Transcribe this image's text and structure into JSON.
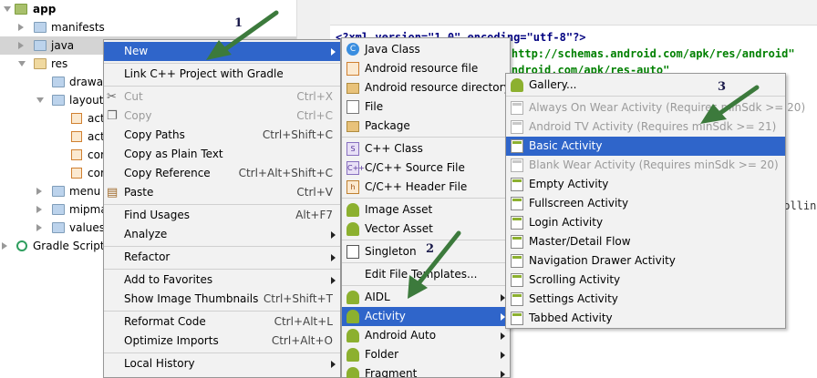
{
  "tree": {
    "items": [
      {
        "label": "app",
        "bold": true
      },
      {
        "label": "manifests"
      },
      {
        "label": "java"
      },
      {
        "label": "res"
      },
      {
        "label": "drawab"
      },
      {
        "label": "layout"
      },
      {
        "label": "act"
      },
      {
        "label": "act"
      },
      {
        "label": "cor"
      },
      {
        "label": "cor"
      },
      {
        "label": "menu"
      },
      {
        "label": "mipma"
      },
      {
        "label": "values"
      },
      {
        "label": "Gradle Scripts"
      }
    ]
  },
  "editor": {
    "line1": "<?xml version=\"1.0\" encoding=\"utf-8\"?>",
    "line2": "id=\"http://schemas.android.com/apk/res/android\"",
    "line3": "as.android.com/apk/res-auto\"",
    "line4": "rollin"
  },
  "context_menu": {
    "items": [
      {
        "label": "New",
        "shortcut": "",
        "submenu": true
      },
      {
        "label": "Link C++ Project with Gradle",
        "shortcut": ""
      },
      {
        "label": "Cut",
        "shortcut": "Ctrl+X",
        "disabled": true
      },
      {
        "label": "Copy",
        "shortcut": "Ctrl+C",
        "disabled": true
      },
      {
        "label": "Copy Paths",
        "shortcut": "Ctrl+Shift+C"
      },
      {
        "label": "Copy as Plain Text",
        "shortcut": ""
      },
      {
        "label": "Copy Reference",
        "shortcut": "Ctrl+Alt+Shift+C"
      },
      {
        "label": "Paste",
        "shortcut": "Ctrl+V"
      },
      {
        "label": "Find Usages",
        "shortcut": "Alt+F7"
      },
      {
        "label": "Analyze",
        "shortcut": "",
        "submenu": true
      },
      {
        "label": "Refactor",
        "shortcut": "",
        "submenu": true
      },
      {
        "label": "Add to Favorites",
        "shortcut": "",
        "submenu": true
      },
      {
        "label": "Show Image Thumbnails",
        "shortcut": "Ctrl+Shift+T"
      },
      {
        "label": "Reformat Code",
        "shortcut": "Ctrl+Alt+L"
      },
      {
        "label": "Optimize Imports",
        "shortcut": "Ctrl+Alt+O"
      },
      {
        "label": "Local History",
        "shortcut": "",
        "submenu": true
      }
    ]
  },
  "new_menu": {
    "items": [
      {
        "label": "Java Class",
        "icon": "java-class-icon"
      },
      {
        "label": "Android resource file",
        "icon": "android-resource-file-icon"
      },
      {
        "label": "Android resource directory",
        "icon": "folder-icon"
      },
      {
        "label": "File",
        "icon": "file-icon"
      },
      {
        "label": "Package",
        "icon": "package-icon"
      },
      {
        "label": "C++ Class",
        "icon": "cpp-class-icon"
      },
      {
        "label": "C/C++ Source File",
        "icon": "cpp-source-icon"
      },
      {
        "label": "C/C++ Header File",
        "icon": "cpp-header-icon"
      },
      {
        "label": "Image Asset",
        "icon": "android-icon"
      },
      {
        "label": "Vector Asset",
        "icon": "android-icon"
      },
      {
        "label": "Singleton",
        "icon": "singleton-icon"
      },
      {
        "label": "Edit File Templates...",
        "icon": ""
      },
      {
        "label": "AIDL",
        "icon": "android-icon",
        "submenu": true
      },
      {
        "label": "Activity",
        "icon": "android-icon",
        "submenu": true
      },
      {
        "label": "Android Auto",
        "icon": "android-icon",
        "submenu": true
      },
      {
        "label": "Folder",
        "icon": "android-icon",
        "submenu": true
      },
      {
        "label": "Fragment",
        "icon": "android-icon",
        "submenu": true
      }
    ]
  },
  "activity_menu": {
    "items": [
      {
        "label": "Gallery...",
        "disabled": false
      },
      {
        "label": "Always On Wear Activity (Requires minSdk >= 20)",
        "disabled": true
      },
      {
        "label": "Android TV Activity (Requires minSdk >= 21)",
        "disabled": true
      },
      {
        "label": "Basic Activity",
        "disabled": false
      },
      {
        "label": "Blank Wear Activity (Requires minSdk >= 20)",
        "disabled": true
      },
      {
        "label": "Empty Activity",
        "disabled": false
      },
      {
        "label": "Fullscreen Activity",
        "disabled": false
      },
      {
        "label": "Login Activity",
        "disabled": false
      },
      {
        "label": "Master/Detail Flow",
        "disabled": false
      },
      {
        "label": "Navigation Drawer Activity",
        "disabled": false
      },
      {
        "label": "Scrolling Activity",
        "disabled": false
      },
      {
        "label": "Settings Activity",
        "disabled": false
      },
      {
        "label": "Tabbed Activity",
        "disabled": false
      }
    ]
  },
  "annotations": {
    "n1": "1",
    "n2": "2",
    "n3": "3"
  },
  "colors": {
    "highlight": "#2f65ca",
    "arrow": "#3c7a3c",
    "android_green": "#8cb02f"
  }
}
